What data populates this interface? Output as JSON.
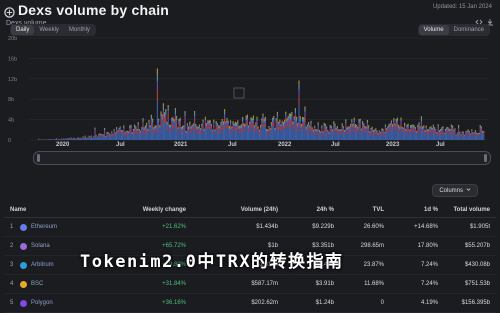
{
  "header": {
    "title": "Dexs volume by chain",
    "subtitle": "Dexs volume",
    "updated": "Updated: 15 Jan 2024"
  },
  "toggles": {
    "left": [
      {
        "label": "Daily",
        "active": true
      },
      {
        "label": "Weekly",
        "active": false
      },
      {
        "label": "Monthly",
        "active": false
      }
    ],
    "right": [
      {
        "label": "Volume",
        "active": true
      },
      {
        "label": "Dominance",
        "active": false
      }
    ]
  },
  "chart_data": {
    "type": "area",
    "title": "",
    "xlabel": "",
    "ylabel": "",
    "y_ticks": [
      "20b",
      "16b",
      "12b",
      "8b",
      "4b",
      "0"
    ],
    "x_ticks": [
      "2020",
      "Jul",
      "2021",
      "Jul",
      "2022",
      "Jul",
      "2023",
      "Jul"
    ],
    "ylim": [
      0,
      20
    ],
    "y_unit": "b",
    "grid": true,
    "series_colors": [
      "#3f67b8",
      "#c04848",
      "#7a4fb8",
      "#4aa5c8",
      "#d29a3a"
    ],
    "x": [
      "2020-01",
      "2020-04",
      "2020-07",
      "2020-10",
      "2021-01",
      "2021-03",
      "2021-05",
      "2021-07",
      "2021-09",
      "2021-11",
      "2022-01",
      "2022-03",
      "2022-05",
      "2022-07",
      "2022-09",
      "2022-11",
      "2023-01",
      "2023-03",
      "2023-05",
      "2023-07",
      "2023-09",
      "2023-11"
    ],
    "total": [
      0.1,
      0.2,
      0.5,
      1.2,
      2.4,
      3.2,
      5.6,
      2.8,
      3.3,
      3.6,
      4.2,
      3.5,
      5.2,
      2.8,
      2.6,
      3.8,
      2.5,
      3.6,
      2.9,
      2.4,
      1.9,
      2.5
    ]
  },
  "watermark": {
    "text": "Tokenim2.0中TRX的转换指南"
  },
  "columns_button": {
    "label": "Columns"
  },
  "table": {
    "headers": {
      "name": "Name",
      "weekly_volume": "Weekly change",
      "volume_24h": "Volume (24h)",
      "volume_24h_pct": "24h %",
      "tvl": "TVL",
      "tvl_pct": "1d %",
      "total_volume": "Total volume"
    },
    "rows": [
      {
        "rank": "1",
        "name": "Ethereum",
        "color": "#627eea",
        "weekly": "+21.62%",
        "weekly_pos": true,
        "v24": "$1.434b",
        "v24p": "$9.229b",
        "tvl": "26.60%",
        "tvlp": "+14.68%",
        "total": "$1.905t"
      },
      {
        "rank": "2",
        "name": "Solana",
        "color": "#9b6bd6",
        "weekly": "+65.72%",
        "weekly_pos": true,
        "v24": "$1b",
        "v24p": "$3.351b",
        "tvl": "298.65m",
        "tvlp": "17.80%",
        "total": "$55.207b"
      },
      {
        "rank": "3",
        "name": "Arbitrum",
        "color": "#2d9cdb",
        "weekly": "+19.89%",
        "weekly_pos": true,
        "v24": "$1.018b",
        "v24p": "$5.46b",
        "tvl": "23.87%",
        "tvlp": "7.24%",
        "total": "$430.08b"
      },
      {
        "rank": "4",
        "name": "BSC",
        "color": "#e2ab2f",
        "weekly": "+31.84%",
        "weekly_pos": true,
        "v24": "$587.17m",
        "v24p": "$3.91b",
        "tvl": "11.68%",
        "tvlp": "7.24%",
        "total": "$751.53b"
      },
      {
        "rank": "5",
        "name": "Polygon",
        "color": "#8247e5",
        "weekly": "+36.16%",
        "weekly_pos": true,
        "v24": "$202.62m",
        "v24p": "$1.24b",
        "tvl": "0",
        "tvlp": "4.19%",
        "total": "$156.395b"
      }
    ]
  }
}
